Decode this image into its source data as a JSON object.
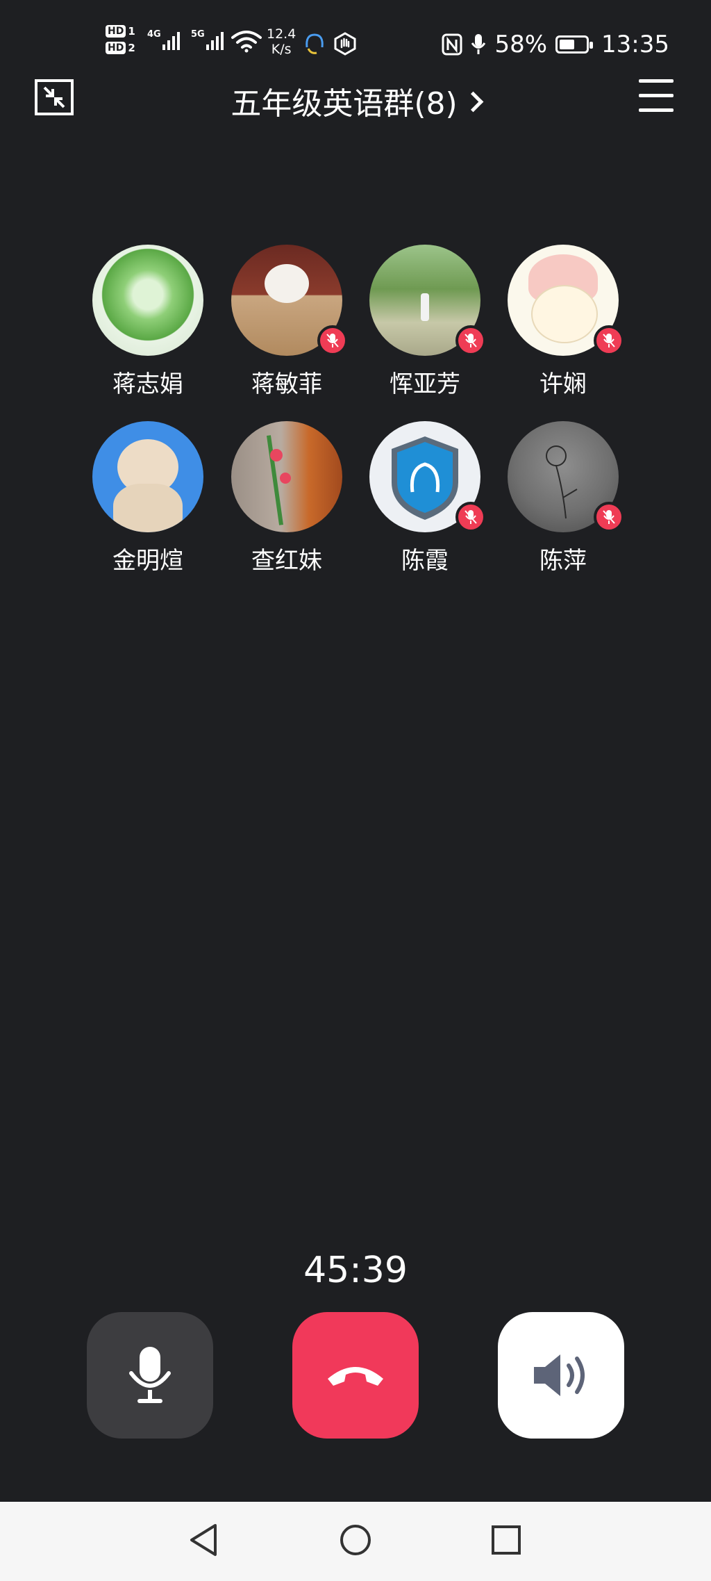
{
  "status_bar": {
    "hd1": "HD",
    "sim1": "1",
    "hd2": "HD",
    "sim2": "2",
    "net1": "4G",
    "net2": "5G",
    "speed_value": "12.4",
    "speed_unit": "K/s",
    "battery": "58%",
    "time": "13:35",
    "battery_level": 0.58
  },
  "header": {
    "title": "五年级英语群(8)"
  },
  "members": [
    {
      "name": "蒋志娟",
      "muted": false,
      "avatar": "flowering-tree"
    },
    {
      "name": "蒋敏菲",
      "muted": true,
      "avatar": "cat-in-bag"
    },
    {
      "name": "恽亚芳",
      "muted": true,
      "avatar": "woman-in-park"
    },
    {
      "name": "许娴",
      "muted": true,
      "avatar": "cartoon-bunny"
    },
    {
      "name": "金明煊",
      "muted": false,
      "avatar": "white-dog"
    },
    {
      "name": "查红妹",
      "muted": false,
      "avatar": "red-flowers"
    },
    {
      "name": "陈霞",
      "muted": true,
      "avatar": "qq-shield"
    },
    {
      "name": "陈萍",
      "muted": true,
      "avatar": "flower-sketch"
    }
  ],
  "call": {
    "duration": "45:39"
  },
  "colors": {
    "background": "#1e1f22",
    "hangup": "#f1395a",
    "mute_badge": "#ef3c55"
  }
}
